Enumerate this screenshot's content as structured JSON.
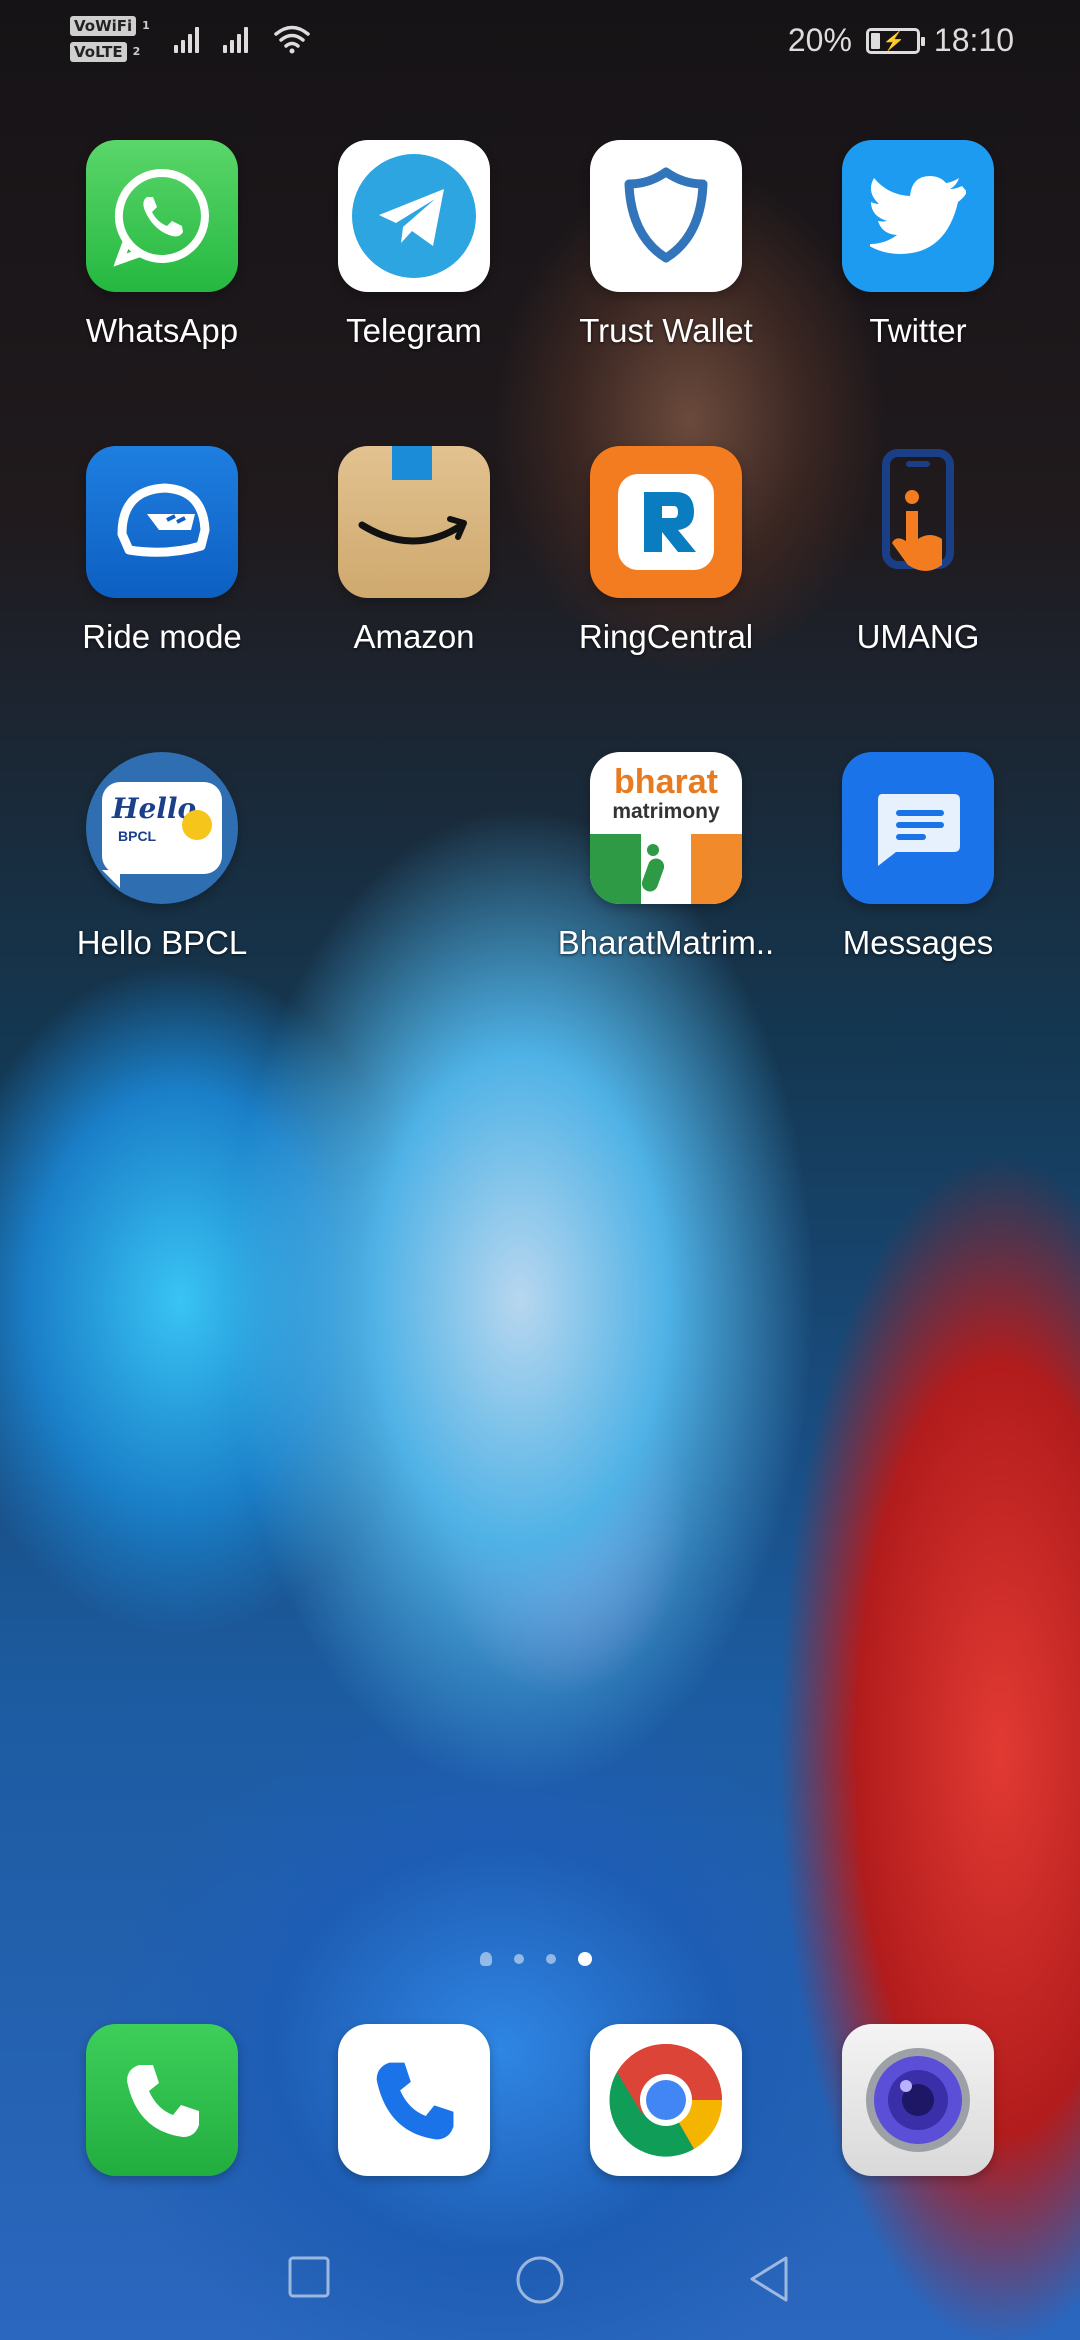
{
  "status_bar": {
    "vowifi": "VoWiFi",
    "vowifi_sim": "1",
    "volte": "VoLTE",
    "volte_sim": "2",
    "battery": "20%",
    "time": "18:10"
  },
  "apps": [
    {
      "label": "WhatsApp",
      "icon": "whatsapp-icon"
    },
    {
      "label": "Telegram",
      "icon": "telegram-icon"
    },
    {
      "label": "Trust Wallet",
      "icon": "trust-wallet-icon"
    },
    {
      "label": "Twitter",
      "icon": "twitter-icon"
    },
    {
      "label": "Ride mode",
      "icon": "ride-mode-icon"
    },
    {
      "label": "Amazon",
      "icon": "amazon-icon"
    },
    {
      "label": "RingCentral",
      "icon": "ringcentral-icon"
    },
    {
      "label": "UMANG",
      "icon": "umang-icon"
    },
    {
      "label": "Hello BPCL",
      "icon": "hello-bpcl-icon"
    },
    {
      "label": "BharatMatrim..",
      "icon": "bharat-matrimony-icon"
    },
    {
      "label": "Messages",
      "icon": "messages-icon"
    }
  ],
  "icon_text": {
    "bpcl_hello": "Hello",
    "bpcl_sub": "BPCL",
    "bharat": "bharat",
    "matrimony": "matrimony"
  },
  "dock": [
    {
      "name": "phone-icon"
    },
    {
      "name": "dialer-icon"
    },
    {
      "name": "chrome-icon"
    },
    {
      "name": "camera-icon"
    }
  ],
  "colors": {
    "whatsapp": "#2fc24a",
    "telegram": "#2ca5e0",
    "twitter": "#1d9bf0",
    "ringcentral": "#f47c20",
    "messages": "#1a73e8"
  }
}
